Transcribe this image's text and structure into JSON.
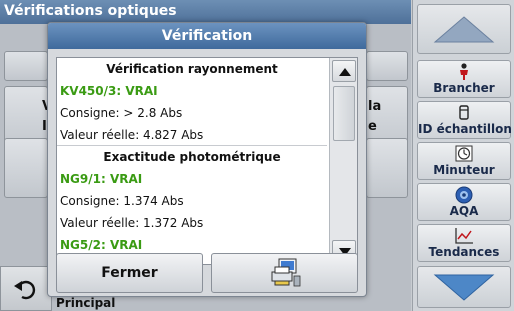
{
  "background": {
    "title": "Vérifications optiques",
    "buttons": [
      {
        "key": "left1",
        "text": "V"
      },
      {
        "key": "left2",
        "text": "I"
      },
      {
        "key": "right1",
        "text": "la"
      },
      {
        "key": "right2",
        "text": "e"
      }
    ],
    "bottom_label": "Principal"
  },
  "sidebar": {
    "items": [
      {
        "label": "Brancher",
        "icon": "person-icon"
      },
      {
        "label": "ID échantillon",
        "icon": "sample-tube-icon"
      },
      {
        "label": "Minuteur",
        "icon": "timer-icon"
      },
      {
        "label": "AQA",
        "icon": "quality-icon"
      },
      {
        "label": "Tendances",
        "icon": "trend-chart-icon"
      }
    ]
  },
  "dialog": {
    "title": "Vérification",
    "rows": [
      {
        "text": "Vérification rayonnement",
        "kind": "header"
      },
      {
        "text": "KV450/3: VRAI",
        "kind": "green"
      },
      {
        "text": "Consigne: > 2.8 Abs",
        "kind": "plain"
      },
      {
        "text": "Valeur réelle:  4.827 Abs",
        "kind": "plain"
      },
      {
        "text": "Exactitude photométrique",
        "kind": "header"
      },
      {
        "text": "NG9/1: VRAI",
        "kind": "green"
      },
      {
        "text": "Consigne:  1.374 Abs",
        "kind": "plain"
      },
      {
        "text": "Valeur réelle:  1.372 Abs",
        "kind": "plain"
      },
      {
        "text": "NG5/2: VRAI",
        "kind": "green"
      }
    ],
    "close_label": "Fermer",
    "print_icon": "print-to-computer-icon"
  },
  "colors": {
    "title_bar": "#3f6a9c",
    "pass_text": "#3a9b13"
  }
}
